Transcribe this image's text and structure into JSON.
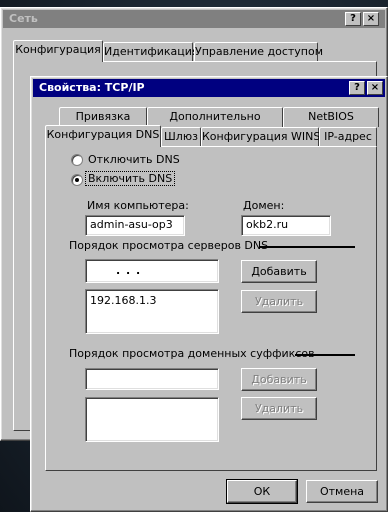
{
  "back_window": {
    "title": "Сеть",
    "tabs": [
      {
        "label": "Конфигурация"
      },
      {
        "label": "Идентификация"
      },
      {
        "label": "Управление доступом"
      }
    ]
  },
  "dialog": {
    "title": "Свойства: TCP/IP",
    "title_help": "?",
    "title_close": "×",
    "tabs_row1": [
      {
        "label": "Привязка"
      },
      {
        "label": "Дополнительно"
      },
      {
        "label": "NetBIOS"
      }
    ],
    "tabs_row2": [
      {
        "label": "Конфигурация DNS"
      },
      {
        "label": "Шлюз"
      },
      {
        "label": "Конфигурация WINS"
      },
      {
        "label": "IP-адрес"
      }
    ],
    "dns": {
      "disable_label": "Отключить DNS",
      "enable_label": "Включить DNS",
      "enabled": true,
      "host_label": "Имя компьютера:",
      "host_value": "admin-asu-op3",
      "domain_label": "Домен:",
      "domain_value": "okb2.ru",
      "server_order_label": "Порядок просмотра серверов DNS",
      "server_ip_input": ".     .     .",
      "add_server_label": "Добавить",
      "servers": [
        "192.168.1.3"
      ],
      "remove_server_label": "Удалить",
      "suffix_order_label": "Порядок просмотра доменных суффиксов",
      "add_suffix_label": "Добавить",
      "remove_suffix_label": "Удалить"
    },
    "ok_label": "ОК",
    "cancel_label": "Отмена"
  }
}
